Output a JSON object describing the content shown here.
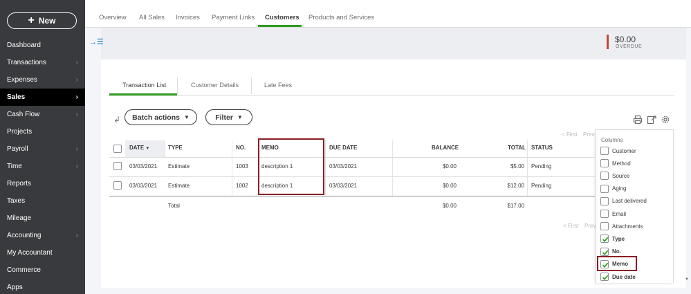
{
  "sidebar": {
    "new_label": "New",
    "items": [
      {
        "label": "Dashboard",
        "chevron": false,
        "active": false
      },
      {
        "label": "Transactions",
        "chevron": true,
        "active": false
      },
      {
        "label": "Expenses",
        "chevron": true,
        "active": false
      },
      {
        "label": "Sales",
        "chevron": true,
        "active": true
      },
      {
        "label": "Cash Flow",
        "chevron": true,
        "active": false
      },
      {
        "label": "Projects",
        "chevron": false,
        "active": false
      },
      {
        "label": "Payroll",
        "chevron": true,
        "active": false
      },
      {
        "label": "Time",
        "chevron": true,
        "active": false
      },
      {
        "label": "Reports",
        "chevron": false,
        "active": false
      },
      {
        "label": "Taxes",
        "chevron": false,
        "active": false
      },
      {
        "label": "Mileage",
        "chevron": false,
        "active": false
      },
      {
        "label": "Accounting",
        "chevron": true,
        "active": false
      },
      {
        "label": "My Accountant",
        "chevron": false,
        "active": false
      },
      {
        "label": "Commerce",
        "chevron": false,
        "active": false
      },
      {
        "label": "Apps",
        "chevron": false,
        "active": false
      }
    ]
  },
  "top_tabs": [
    "Overview",
    "All Sales",
    "Invoices",
    "Payment Links",
    "Customers",
    "Products and Services"
  ],
  "summary": {
    "amount": "$0.00",
    "label": "OVERDUE"
  },
  "sub_tabs": [
    "Transaction List",
    "Customer Details",
    "Late Fees"
  ],
  "toolbar": {
    "batch_label": "Batch actions",
    "filter_label": "Filter"
  },
  "pager": {
    "first": "< First",
    "prev": "Prev"
  },
  "table": {
    "headers": {
      "date": "DATE",
      "type": "TYPE",
      "no": "NO.",
      "memo": "MEMO",
      "due_date": "DUE DATE",
      "balance": "BALANCE",
      "total": "TOTAL",
      "status": "STATUS"
    },
    "rows": [
      {
        "date": "03/03/2021",
        "type": "Estimate",
        "no": "1003",
        "memo": "description 1",
        "due_date": "03/03/2021",
        "balance": "$0.00",
        "total": "$5.00",
        "status": "Pending"
      },
      {
        "date": "03/03/2021",
        "type": "Estimate",
        "no": "1002",
        "memo": "description 1",
        "due_date": "03/03/2021",
        "balance": "$0.00",
        "total": "$12.00",
        "status": "Pending"
      }
    ],
    "totals": {
      "label": "Total",
      "balance": "$0.00",
      "total": "$17.00"
    }
  },
  "columns_popup": {
    "title": "Columns",
    "items": [
      {
        "label": "Customer",
        "checked": false,
        "bold": false
      },
      {
        "label": "Method",
        "checked": false,
        "bold": false
      },
      {
        "label": "Source",
        "checked": false,
        "bold": false
      },
      {
        "label": "Aging",
        "checked": false,
        "bold": false
      },
      {
        "label": "Last delivered",
        "checked": false,
        "bold": false
      },
      {
        "label": "Email",
        "checked": false,
        "bold": false
      },
      {
        "label": "Attachments",
        "checked": false,
        "bold": false
      },
      {
        "label": "Type",
        "checked": true,
        "bold": true
      },
      {
        "label": "No.",
        "checked": true,
        "bold": true
      },
      {
        "label": "Memo",
        "checked": true,
        "bold": true
      },
      {
        "label": "Due date",
        "checked": true,
        "bold": true
      }
    ]
  },
  "colors": {
    "accent_green": "#2ca01c",
    "sidebar_bg": "#393a3d",
    "overdue_red": "#c84530",
    "highlight": "#8b1c24"
  }
}
